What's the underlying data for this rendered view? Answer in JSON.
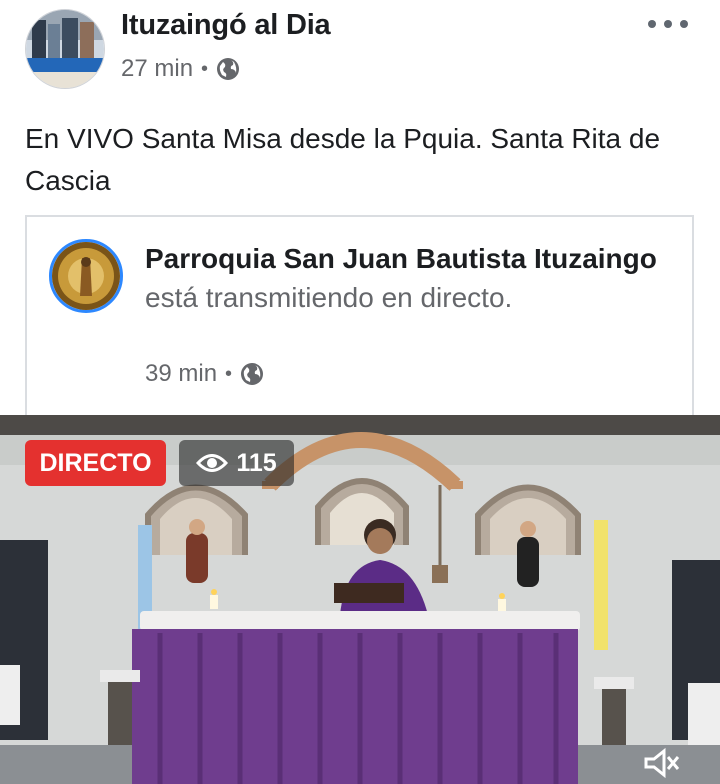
{
  "post": {
    "author": "Ituzaingó al Dia",
    "time": "27 min",
    "separator": "•",
    "text": "En VIVO Santa Misa desde la Pquia. Santa Rita de Cascia",
    "privacy_icon": "globe-icon",
    "more_icon": "more-options-icon"
  },
  "shared": {
    "page_name": "Parroquia San Juan Bautista Ituzaingo",
    "status": " está transmitiendo en directo.",
    "time": "39 min",
    "separator": "•"
  },
  "video": {
    "live_label": "DIRECTO",
    "viewer_count": "115",
    "viewer_icon": "eye-icon",
    "volume_icon": "volume-icon"
  },
  "colors": {
    "live_badge": "#e4312f",
    "avatar_ring": "#2d88ff",
    "secondary_text": "#65676b",
    "altar_cloth": "#6f3d8e"
  }
}
